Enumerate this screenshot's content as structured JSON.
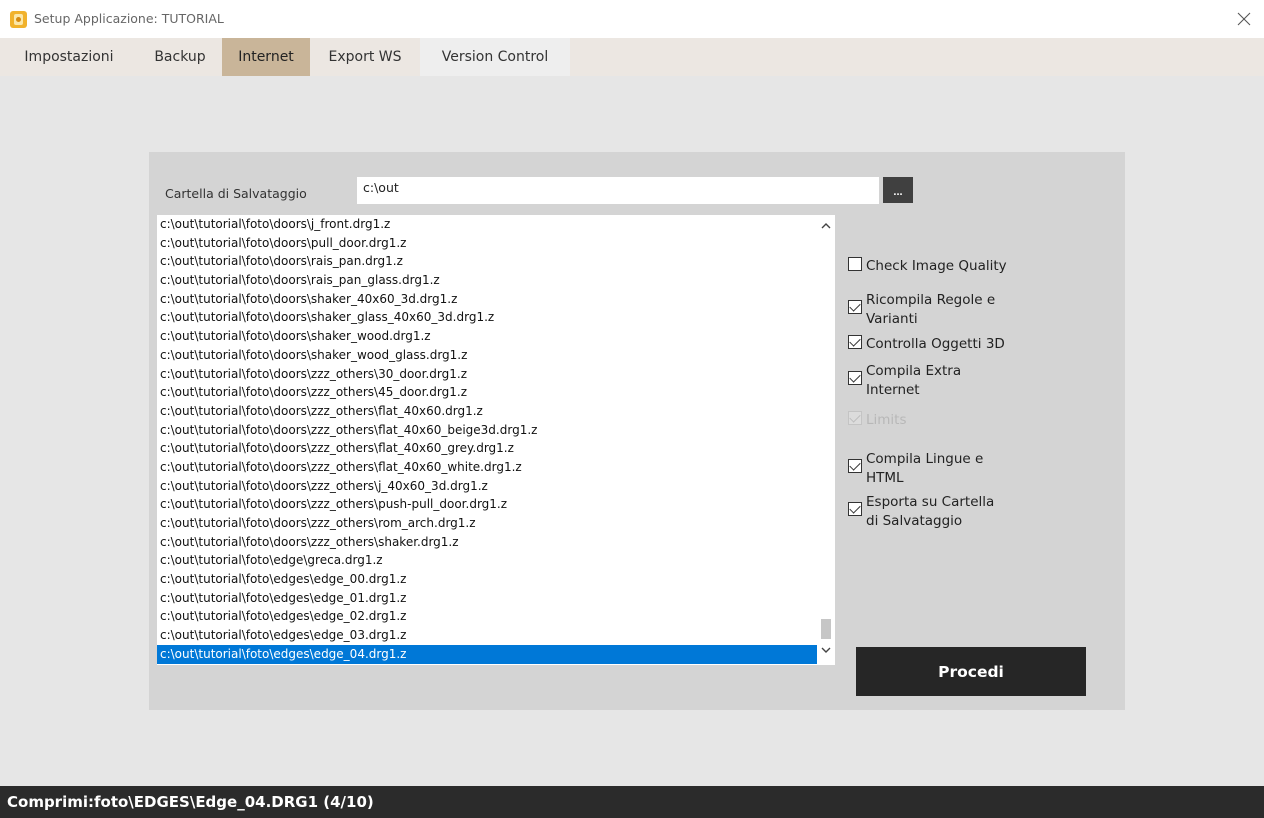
{
  "window": {
    "title": "Setup Applicazione: TUTORIAL",
    "icon": "app-icon",
    "close_icon": "close-icon"
  },
  "tabs": [
    {
      "label": "Impostazioni",
      "active": false
    },
    {
      "label": "Backup",
      "active": false
    },
    {
      "label": "Internet",
      "active": true
    },
    {
      "label": "Export WS",
      "active": false
    },
    {
      "label": "Version Control",
      "active": false
    }
  ],
  "folder": {
    "label": "Cartella di Salvataggio",
    "value": "c:\\out",
    "browse_label": "..."
  },
  "file_list": {
    "items": [
      "c:\\out\\tutorial\\foto\\doors\\j_front.drg1.z",
      "c:\\out\\tutorial\\foto\\doors\\pull_door.drg1.z",
      "c:\\out\\tutorial\\foto\\doors\\rais_pan.drg1.z",
      "c:\\out\\tutorial\\foto\\doors\\rais_pan_glass.drg1.z",
      "c:\\out\\tutorial\\foto\\doors\\shaker_40x60_3d.drg1.z",
      "c:\\out\\tutorial\\foto\\doors\\shaker_glass_40x60_3d.drg1.z",
      "c:\\out\\tutorial\\foto\\doors\\shaker_wood.drg1.z",
      "c:\\out\\tutorial\\foto\\doors\\shaker_wood_glass.drg1.z",
      "c:\\out\\tutorial\\foto\\doors\\zzz_others\\30_door.drg1.z",
      "c:\\out\\tutorial\\foto\\doors\\zzz_others\\45_door.drg1.z",
      "c:\\out\\tutorial\\foto\\doors\\zzz_others\\flat_40x60.drg1.z",
      "c:\\out\\tutorial\\foto\\doors\\zzz_others\\flat_40x60_beige3d.drg1.z",
      "c:\\out\\tutorial\\foto\\doors\\zzz_others\\flat_40x60_grey.drg1.z",
      "c:\\out\\tutorial\\foto\\doors\\zzz_others\\flat_40x60_white.drg1.z",
      "c:\\out\\tutorial\\foto\\doors\\zzz_others\\j_40x60_3d.drg1.z",
      "c:\\out\\tutorial\\foto\\doors\\zzz_others\\push-pull_door.drg1.z",
      "c:\\out\\tutorial\\foto\\doors\\zzz_others\\rom_arch.drg1.z",
      "c:\\out\\tutorial\\foto\\doors\\zzz_others\\shaker.drg1.z",
      "c:\\out\\tutorial\\foto\\edge\\greca.drg1.z",
      "c:\\out\\tutorial\\foto\\edges\\edge_00.drg1.z",
      "c:\\out\\tutorial\\foto\\edges\\edge_01.drg1.z",
      "c:\\out\\tutorial\\foto\\edges\\edge_02.drg1.z",
      "c:\\out\\tutorial\\foto\\edges\\edge_03.drg1.z",
      "c:\\out\\tutorial\\foto\\edges\\edge_04.drg1.z"
    ],
    "selected_index": 23,
    "scroll_up_icon": "chevron-up-icon",
    "scroll_down_icon": "chevron-down-icon"
  },
  "options": [
    {
      "label": "Check Image Quality",
      "checked": false,
      "disabled": false
    },
    {
      "label": "Ricompila Regole e Varianti",
      "checked": true,
      "disabled": false
    },
    {
      "label": "Controlla Oggetti 3D",
      "checked": true,
      "disabled": false
    },
    {
      "label": "Compila Extra Internet",
      "checked": true,
      "disabled": false
    },
    {
      "label": "Limits",
      "checked": true,
      "disabled": true
    },
    {
      "label": "Compila Lingue e HTML",
      "checked": true,
      "disabled": false
    },
    {
      "label": "Esporta su Cartella di Salvataggio",
      "checked": true,
      "disabled": false
    }
  ],
  "procedi_label": "Procedi",
  "status": {
    "text": "Comprimi:foto\\EDGES\\Edge_04.DRG1  (4/10)"
  },
  "colors": {
    "active_tab": "#c9b599",
    "selection": "#0078d7",
    "button_dark": "#262626",
    "status_bar": "#2b2b2b"
  }
}
